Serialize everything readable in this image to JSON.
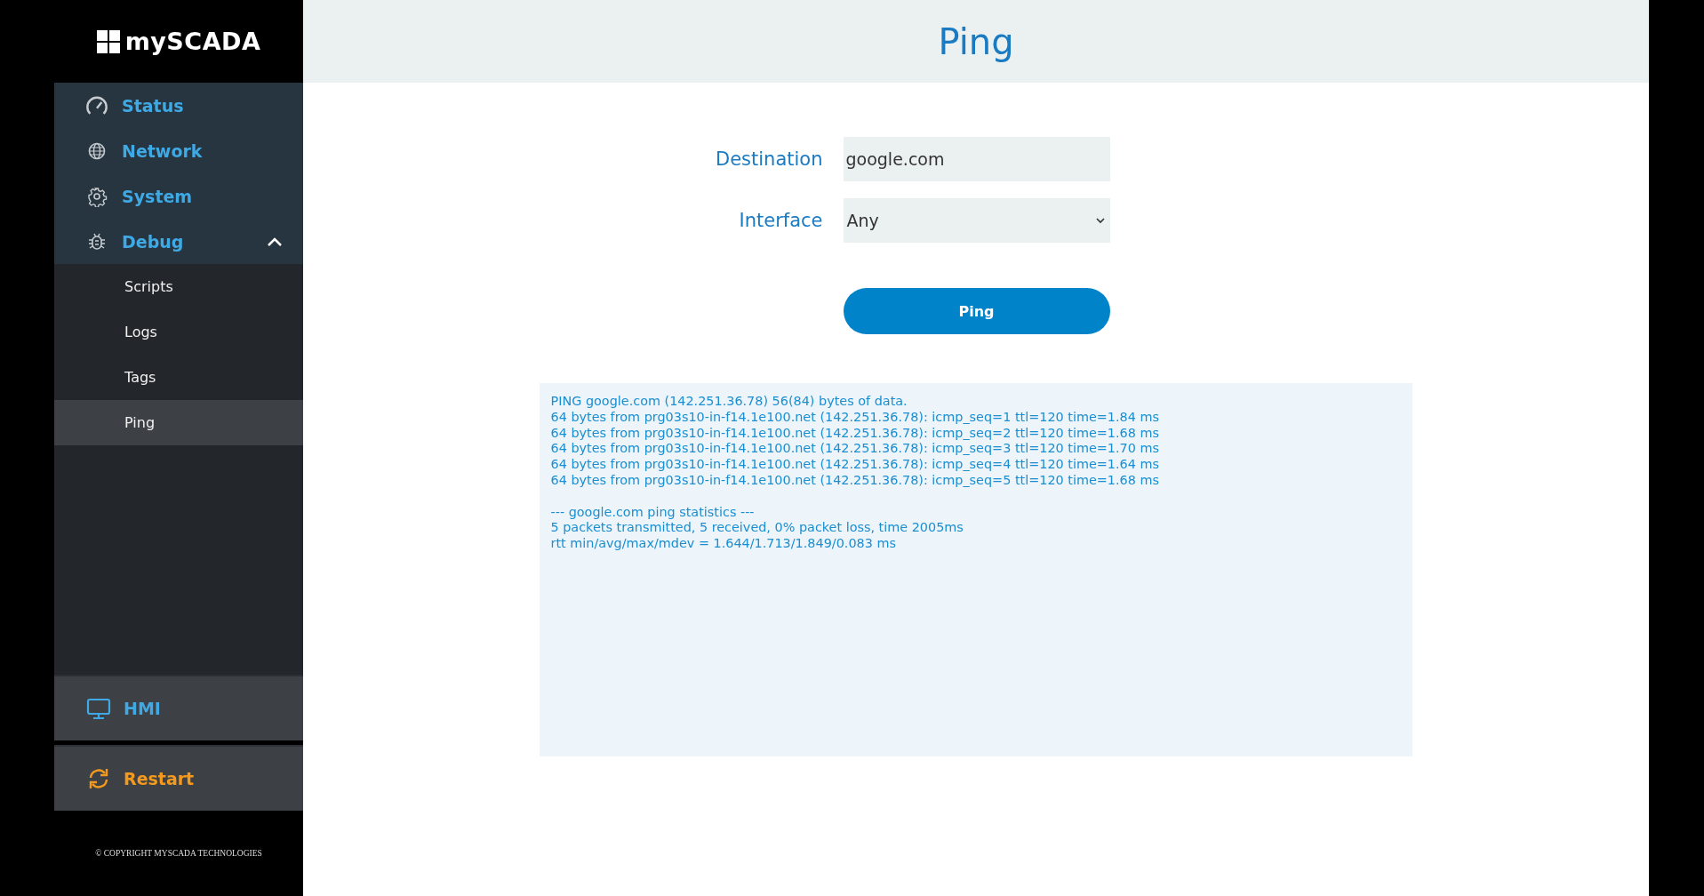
{
  "brand": {
    "name": "mySCADA"
  },
  "nav": [
    {
      "label": "Status",
      "selected": false
    },
    {
      "label": "Network",
      "selected": false
    },
    {
      "label": "System",
      "selected": false
    },
    {
      "label": "Debug",
      "selected": false,
      "expanded": true,
      "children": [
        {
          "label": "Scripts",
          "selected": false
        },
        {
          "label": "Logs",
          "selected": false
        },
        {
          "label": "Tags",
          "selected": false
        },
        {
          "label": "Ping",
          "selected": true
        }
      ]
    }
  ],
  "bottom_nav": [
    {
      "kind": "hmi",
      "label": "HMI"
    },
    {
      "kind": "restart",
      "label": "Restart"
    }
  ],
  "copyright": "© COPYRIGHT MYSCADA TECHNOLOGIES",
  "page": {
    "title": "Ping"
  },
  "form": {
    "destination": {
      "label": "Destination",
      "value": "google.com"
    },
    "interface": {
      "label": "Interface",
      "value": "Any"
    },
    "button": "Ping"
  },
  "output": [
    [
      "PING google.com (142.251.36.78) 56(84) bytes of data.",
      "64 bytes from prg03s10-in-f14.1e100.net (142.251.36.78): icmp_seq=1 ttl=120 time=1.84 ms",
      "64 bytes from prg03s10-in-f14.1e100.net (142.251.36.78): icmp_seq=2 ttl=120 time=1.68 ms",
      "64 bytes from prg03s10-in-f14.1e100.net (142.251.36.78): icmp_seq=3 ttl=120 time=1.70 ms",
      "64 bytes from prg03s10-in-f14.1e100.net (142.251.36.78): icmp_seq=4 ttl=120 time=1.64 ms",
      "64 bytes from prg03s10-in-f14.1e100.net (142.251.36.78): icmp_seq=5 ttl=120 time=1.68 ms"
    ],
    [
      "--- google.com ping statistics ---",
      "5 packets transmitted, 5 received, 0% packet loss, time 2005ms",
      "rtt min/avg/max/mdev = 1.644/1.713/1.849/0.083 ms"
    ]
  ]
}
